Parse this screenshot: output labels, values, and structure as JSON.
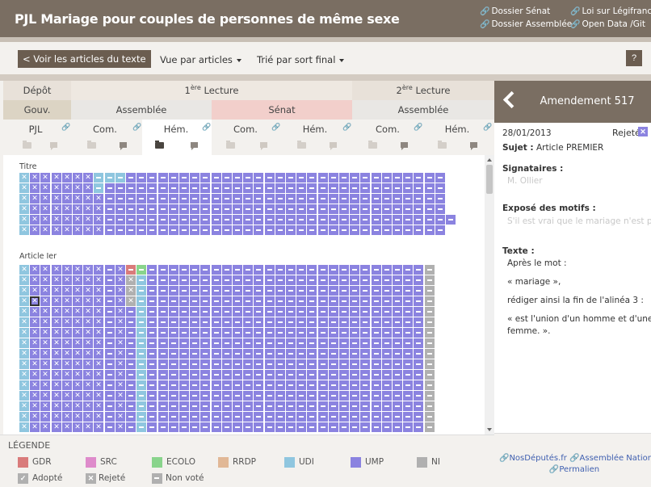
{
  "header": {
    "title": "PJL Mariage pour couples de personnes de même sexe",
    "links": [
      "Dossier Sénat",
      "Loi sur Légifrance",
      "Dossier Assemblée",
      "Open Data",
      "/Git"
    ]
  },
  "toolbar": {
    "back_label": "< Voir les articles du texte",
    "view_label": "Vue par articles",
    "sort_label": "Trié par sort final",
    "help_label": "?"
  },
  "columns": {
    "row1": {
      "depot": "Dépôt",
      "lecture1_num": "1",
      "lecture1_sup": "ère",
      "lecture1_text": " Lecture",
      "lecture2_num": "2",
      "lecture2_sup": "ère",
      "lecture2_text": " Lecture"
    },
    "row2": {
      "gouv": "Gouv.",
      "assemblee1": "Assemblée",
      "senat": "Sénat",
      "assemblee2": "Assemblée"
    },
    "row3": [
      "PJL",
      "Com.",
      "Hém.",
      "Com.",
      "Hém.",
      "Com.",
      "Hém."
    ]
  },
  "grid": {
    "sections": [
      {
        "label": "Titre",
        "rows": 6
      },
      {
        "label": "Article Ier",
        "rows": 16
      }
    ]
  },
  "legend": {
    "title": "LÉGENDE",
    "groups": [
      {
        "name": "GDR",
        "color": "#d97b7b"
      },
      {
        "name": "SRC",
        "color": "#de8bcb"
      },
      {
        "name": "ECOLO",
        "color": "#89d48c"
      },
      {
        "name": "RRDP",
        "color": "#e1b896"
      },
      {
        "name": "UDI",
        "color": "#8fc6df"
      },
      {
        "name": "UMP",
        "color": "#8b83e0"
      },
      {
        "name": "NI",
        "color": "#b0b0b0"
      }
    ],
    "states": [
      {
        "name": "Adopté",
        "icon": "check-icon"
      },
      {
        "name": "Rejeté",
        "icon": "cross-icon"
      },
      {
        "name": "Non voté",
        "icon": "dash-icon"
      }
    ]
  },
  "panel": {
    "title": "Amendement 517",
    "date": "28/01/2013",
    "status": "Rejeté",
    "subject_label": "Sujet :",
    "subject": "Article PREMIER",
    "signataires_label": "Signataires :",
    "signataires": "M. Ollier",
    "expose_label": "Exposé des motifs :",
    "expose": "S'il est vrai que le mariage n'est pas",
    "texte_label": "Texte :",
    "texte_lines": [
      "Après le mot :",
      "« mariage »,",
      "rédiger ainsi la fin de l'alinéa 3 :",
      "« est l'union d'un homme et d'une",
      "femme. »."
    ],
    "links": [
      "NosDéputés.fr",
      "Assemblée Nationale",
      "Permalien"
    ]
  }
}
